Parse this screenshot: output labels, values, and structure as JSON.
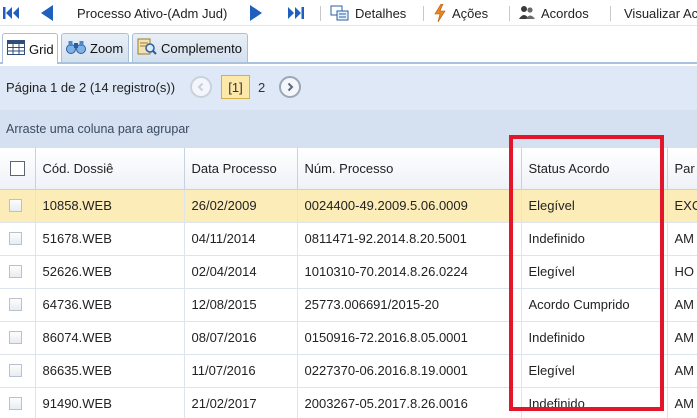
{
  "toolbar": {
    "process_label": "Processo Ativo-(Adm Jud)",
    "details_label": "Detalhes",
    "actions_label": "Ações",
    "agreements_label": "Acordos",
    "view_label": "Visualizar Acor"
  },
  "tabs": [
    {
      "label": "Grid"
    },
    {
      "label": "Zoom"
    },
    {
      "label": "Complemento"
    }
  ],
  "pager": {
    "info": "Página 1 de 2 (14 registro(s))",
    "current_page": "[1]",
    "next_page": "2"
  },
  "group_hint": "Arraste uma coluna para agrupar",
  "grid": {
    "headers": [
      "Cód. Dossiê",
      "Data Processo",
      "Núm. Processo",
      "Status Acordo",
      "Par"
    ],
    "rows": [
      {
        "code": "10858.WEB",
        "date": "26/02/2009",
        "number": "0024400-49.2009.5.06.0009",
        "status": "Elegível",
        "extra": "EXC"
      },
      {
        "code": "51678.WEB",
        "date": "04/11/2014",
        "number": "0811471-92.2014.8.20.5001",
        "status": "Indefinido",
        "extra": "AM"
      },
      {
        "code": "52626.WEB",
        "date": "02/04/2014",
        "number": "1010310-70.2014.8.26.0224",
        "status": "Elegível",
        "extra": "HO"
      },
      {
        "code": "64736.WEB",
        "date": "12/08/2015",
        "number": "25773.006691/2015-20",
        "status": "Acordo Cumprido",
        "extra": "AM"
      },
      {
        "code": "86074.WEB",
        "date": "08/07/2016",
        "number": "0150916-72.2016.8.05.0001",
        "status": "Indefinido",
        "extra": "AM"
      },
      {
        "code": "86635.WEB",
        "date": "11/07/2016",
        "number": "0227370-06.2016.8.19.0001",
        "status": "Elegível",
        "extra": "AM"
      },
      {
        "code": "91490.WEB",
        "date": "21/02/2017",
        "number": "2003267-05.2017.8.26.0016",
        "status": "Indefinido",
        "extra": "AM"
      }
    ]
  },
  "colors": {
    "selected_row": "#fcecb8",
    "highlight_border": "#e3152a",
    "nav_blue": "#1f5fbf"
  }
}
